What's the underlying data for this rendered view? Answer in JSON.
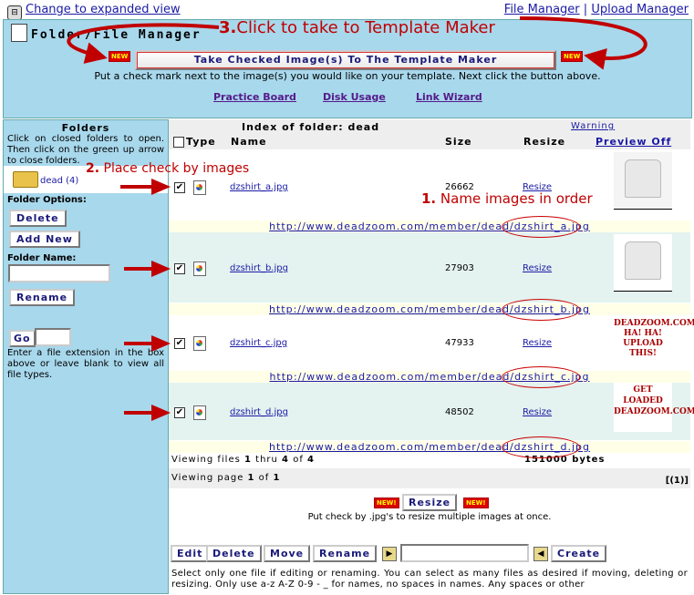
{
  "top": {
    "expand_link": "Change to expanded view",
    "file_manager_link": "File Manager",
    "separator": "|",
    "upload_manager_link": "Upload Manager"
  },
  "panel": {
    "title": "Folder/File Manager",
    "take_button": "Take Checked Image(s) To The Template Maker",
    "new_badge": "NEW",
    "hint": "Put a check mark next to the image(s) you would like on your template. Next click the button above.",
    "links": [
      "Practice Board",
      "Disk Usage",
      "Link Wizard"
    ]
  },
  "annotations": {
    "step3_num": "3.",
    "step3_text": "Click to take to Template Maker",
    "step2_num": "2.",
    "step2_text": "Place check by images",
    "step1_num": "1.",
    "step1_text": "Name images in order"
  },
  "sidebar": {
    "heading": "Folders",
    "desc": "Click on closed folders to open. Then click on the green up arrow to close folders.",
    "folder_name": "dead (4)",
    "folder_options_label": "Folder Options:",
    "delete_btn": "Delete",
    "add_new_btn": "Add New",
    "folder_name_label": "Folder Name:",
    "rename_btn": "Rename",
    "go_btn": "Go",
    "ext_hint": "Enter a file extension in the box above or leave blank to view all file types."
  },
  "table": {
    "index_title": "Index of folder: dead",
    "warning_link": "Warning",
    "col_type": "Type",
    "col_name": "Name",
    "col_size": "Size",
    "col_resize": "Resize",
    "preview_link": "Preview Off",
    "files": [
      {
        "name": "dzshirt_a.jpg",
        "size": "26662",
        "resize": "Resize",
        "url": "http://www.deadzoom.com/member/dead/dzshirt_a.jpg",
        "thumb": "shirt"
      },
      {
        "name": "dzshirt_b.jpg",
        "size": "27903",
        "resize": "Resize",
        "url": "http://www.deadzoom.com/member/dead/dzshirt_b.jpg",
        "thumb": "shirt"
      },
      {
        "name": "dzshirt_c.jpg",
        "size": "47933",
        "resize": "Resize",
        "url": "http://www.deadzoom.com/member/dead/dzshirt_c.jpg",
        "thumb": "DEADZOOM.COM HA! HA! UPLOAD THIS!"
      },
      {
        "name": "dzshirt_d.jpg",
        "size": "48502",
        "resize": "Resize",
        "url": "http://www.deadzoom.com/member/dead/dzshirt_d.jpg",
        "thumb": "GET LOADED DEADZOOM.COM"
      }
    ],
    "viewing_prefix": "Viewing files ",
    "viewing_from": "1",
    "viewing_thru": " thru ",
    "viewing_to": "4",
    "viewing_of": " of ",
    "viewing_total": "4",
    "total_bytes": "151000 bytes",
    "page_prefix": "Viewing page ",
    "page_num": "1",
    "page_of": " of ",
    "page_total": "1",
    "pager": "[(1)]"
  },
  "actions": {
    "new_badge": "NEW!",
    "resize_btn": "Resize",
    "resize_hint": "Put check by .jpg's to resize multiple images at once.",
    "edit_btn": "Edit",
    "delete_btn": "Delete",
    "move_btn": "Move",
    "rename_btn": "Rename",
    "create_btn": "Create",
    "footer_text": "Select only one file if editing or renaming. You can select as many files as desired if moving, deleting or resizing. Only use a-z A-Z 0-9 - _ for names, no spaces in names. Any spaces or other"
  },
  "colors": {
    "panel_bg": "#a8d8ec",
    "annotation_red": "#c00000",
    "link_blue": "#1a1aa6"
  }
}
